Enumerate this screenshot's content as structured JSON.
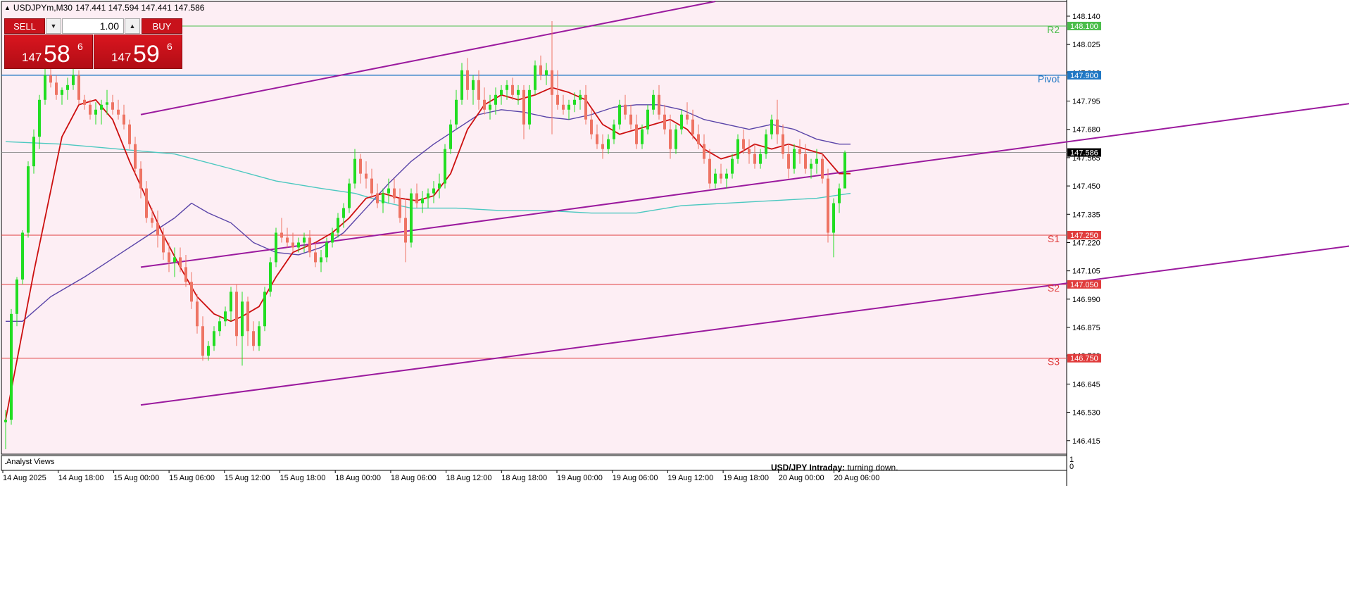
{
  "header": {
    "symbol_info": "USDJPYm,M30",
    "ohlc": "147.441 147.594 147.441 147.586"
  },
  "trade_panel": {
    "sell_label": "SELL",
    "buy_label": "BUY",
    "lot_value": "1.00",
    "sell_price": {
      "prefix": "147",
      "big": "58",
      "sup": "6"
    },
    "buy_price": {
      "prefix": "147",
      "big": "59",
      "sup": "6"
    }
  },
  "indicator_window": {
    "label": ".Analyst Views",
    "caption_bold": "USD/JPY Intraday:",
    "caption_text": "turning down.",
    "scale_top": "1",
    "scale_bottom": "0"
  },
  "colors": {
    "background": "#fdeef4",
    "bull": "#22dd22",
    "bear": "#ee7464",
    "ma_fast": "#cc0f0f",
    "ma_mid": "#5a44a8",
    "ma_slow": "#4cc8c0",
    "channel": "#9b1a9e",
    "pivot": "#1f77c4",
    "resistance": "#4bbd4b",
    "support": "#e03c3c"
  },
  "chart_data": {
    "type": "candlestick",
    "symbol": "USDJPYm",
    "timeframe": "M30",
    "ylim": [
      146.36,
      148.2
    ],
    "y_ticks": [
      "148.140",
      "148.025",
      "147.910",
      "147.795",
      "147.680",
      "147.565",
      "147.450",
      "147.335",
      "147.220",
      "147.105",
      "146.990",
      "146.875",
      "146.760",
      "146.645",
      "146.530",
      "146.415"
    ],
    "x_ticks": [
      "14 Aug 2025",
      "14 Aug 18:00",
      "15 Aug 00:00",
      "15 Aug 06:00",
      "15 Aug 12:00",
      "15 Aug 18:00",
      "18 Aug 00:00",
      "18 Aug 06:00",
      "18 Aug 12:00",
      "18 Aug 18:00",
      "19 Aug 00:00",
      "19 Aug 06:00",
      "19 Aug 12:00",
      "19 Aug 18:00",
      "20 Aug 00:00",
      "20 Aug 06:00"
    ],
    "levels": [
      {
        "name": "R2",
        "value": 148.1,
        "label": "148.100"
      },
      {
        "name": "Pivot",
        "value": 147.9,
        "label": "147.900"
      },
      {
        "name": "S1",
        "value": 147.25,
        "label": "147.250"
      },
      {
        "name": "S2",
        "value": 147.05,
        "label": "147.050"
      },
      {
        "name": "S3",
        "value": 146.75,
        "label": "146.750"
      }
    ],
    "current_price": {
      "value": 147.586,
      "label": "147.586"
    },
    "channel": {
      "upper": [
        [
          24,
          147.74
        ],
        [
          126,
          148.2
        ]
      ],
      "upper2": [
        [
          24,
          147.12
        ],
        [
          250,
          147.82
        ]
      ],
      "lower": [
        [
          24,
          146.56
        ],
        [
          250,
          147.24
        ]
      ]
    },
    "candles": [
      [
        146.49,
        146.54,
        146.38,
        146.5
      ],
      [
        146.5,
        146.95,
        146.48,
        146.93
      ],
      [
        146.93,
        147.08,
        146.88,
        147.07
      ],
      [
        147.07,
        147.27,
        147.05,
        147.26
      ],
      [
        147.26,
        147.55,
        147.24,
        147.53
      ],
      [
        147.53,
        147.68,
        147.5,
        147.65
      ],
      [
        147.65,
        147.82,
        147.6,
        147.8
      ],
      [
        147.8,
        147.93,
        147.78,
        147.9
      ],
      [
        147.9,
        147.96,
        147.85,
        147.87
      ],
      [
        147.87,
        147.9,
        147.8,
        147.82
      ],
      [
        147.82,
        147.85,
        147.78,
        147.84
      ],
      [
        147.84,
        147.89,
        147.8,
        147.86
      ],
      [
        147.86,
        147.95,
        147.84,
        147.9
      ],
      [
        147.9,
        147.92,
        147.78,
        147.8
      ],
      [
        147.8,
        147.82,
        147.76,
        147.78
      ],
      [
        147.78,
        147.8,
        147.72,
        147.74
      ],
      [
        147.74,
        147.79,
        147.7,
        147.76
      ],
      [
        147.76,
        147.8,
        147.7,
        147.78
      ],
      [
        147.78,
        147.84,
        147.74,
        147.79
      ],
      [
        147.79,
        147.82,
        147.74,
        147.76
      ],
      [
        147.76,
        147.8,
        147.72,
        147.74
      ],
      [
        147.74,
        147.78,
        147.68,
        147.7
      ],
      [
        147.7,
        147.72,
        147.6,
        147.62
      ],
      [
        147.62,
        147.65,
        147.5,
        147.52
      ],
      [
        147.52,
        147.55,
        147.4,
        147.44
      ],
      [
        147.44,
        147.47,
        147.3,
        147.32
      ],
      [
        147.32,
        147.36,
        147.28,
        147.3
      ],
      [
        147.3,
        147.35,
        147.2,
        147.25
      ],
      [
        147.25,
        147.28,
        147.15,
        147.18
      ],
      [
        147.18,
        147.22,
        147.1,
        147.14
      ],
      [
        147.14,
        147.2,
        147.08,
        147.16
      ],
      [
        147.16,
        147.2,
        147.1,
        147.12
      ],
      [
        147.12,
        147.17,
        147.04,
        147.06
      ],
      [
        147.06,
        147.1,
        146.95,
        146.98
      ],
      [
        146.98,
        147.01,
        146.85,
        146.88
      ],
      [
        146.88,
        146.92,
        146.74,
        146.76
      ],
      [
        146.76,
        146.82,
        146.74,
        146.8
      ],
      [
        146.8,
        146.88,
        146.78,
        146.86
      ],
      [
        146.86,
        146.92,
        146.84,
        146.9
      ],
      [
        146.9,
        146.96,
        146.88,
        146.94
      ],
      [
        146.94,
        147.04,
        146.9,
        147.02
      ],
      [
        147.02,
        147.05,
        146.8,
        146.84
      ],
      [
        146.84,
        147.02,
        146.72,
        146.98
      ],
      [
        146.98,
        147.0,
        146.8,
        146.86
      ],
      [
        146.86,
        146.9,
        146.78,
        146.8
      ],
      [
        146.8,
        146.9,
        146.78,
        146.88
      ],
      [
        146.88,
        147.04,
        146.86,
        147.02
      ],
      [
        147.02,
        147.16,
        147.0,
        147.14
      ],
      [
        147.14,
        147.28,
        147.12,
        147.26
      ],
      [
        147.26,
        147.32,
        147.22,
        147.24
      ],
      [
        147.24,
        147.28,
        147.2,
        147.22
      ],
      [
        147.22,
        147.26,
        147.18,
        147.2
      ],
      [
        147.2,
        147.24,
        147.18,
        147.22
      ],
      [
        147.22,
        147.26,
        147.18,
        147.24
      ],
      [
        147.24,
        147.27,
        147.16,
        147.18
      ],
      [
        147.18,
        147.22,
        147.12,
        147.14
      ],
      [
        147.14,
        147.19,
        147.1,
        147.16
      ],
      [
        147.16,
        147.24,
        147.14,
        147.22
      ],
      [
        147.22,
        147.28,
        147.2,
        147.26
      ],
      [
        147.26,
        147.34,
        147.24,
        147.32
      ],
      [
        147.32,
        147.38,
        147.28,
        147.36
      ],
      [
        147.36,
        147.48,
        147.34,
        147.46
      ],
      [
        147.46,
        147.6,
        147.44,
        147.56
      ],
      [
        147.56,
        147.58,
        147.46,
        147.5
      ],
      [
        147.5,
        147.55,
        147.44,
        147.48
      ],
      [
        147.48,
        147.52,
        147.4,
        147.42
      ],
      [
        147.42,
        147.46,
        147.36,
        147.38
      ],
      [
        147.38,
        147.44,
        147.34,
        147.42
      ],
      [
        147.42,
        147.48,
        147.38,
        147.44
      ],
      [
        147.44,
        147.48,
        147.38,
        147.4
      ],
      [
        147.4,
        147.44,
        147.3,
        147.32
      ],
      [
        147.32,
        147.4,
        147.14,
        147.22
      ],
      [
        147.22,
        147.44,
        147.2,
        147.42
      ],
      [
        147.42,
        147.46,
        147.36,
        147.38
      ],
      [
        147.38,
        147.43,
        147.34,
        147.4
      ],
      [
        147.4,
        147.44,
        147.36,
        147.42
      ],
      [
        147.42,
        147.47,
        147.38,
        147.44
      ],
      [
        147.44,
        147.5,
        147.4,
        147.46
      ],
      [
        147.46,
        147.62,
        147.44,
        147.6
      ],
      [
        147.6,
        147.72,
        147.58,
        147.7
      ],
      [
        147.7,
        147.84,
        147.68,
        147.8
      ],
      [
        147.8,
        147.95,
        147.78,
        147.92
      ],
      [
        147.92,
        147.97,
        147.8,
        147.84
      ],
      [
        147.84,
        147.9,
        147.78,
        147.88
      ],
      [
        147.88,
        147.92,
        147.76,
        147.8
      ],
      [
        147.8,
        147.85,
        147.74,
        147.76
      ],
      [
        147.76,
        147.82,
        147.72,
        147.78
      ],
      [
        147.78,
        147.85,
        147.74,
        147.82
      ],
      [
        147.82,
        147.86,
        147.78,
        147.84
      ],
      [
        147.84,
        147.88,
        147.8,
        147.86
      ],
      [
        147.86,
        147.89,
        147.8,
        147.82
      ],
      [
        147.82,
        147.86,
        147.78,
        147.84
      ],
      [
        147.84,
        147.86,
        147.64,
        147.7
      ],
      [
        147.7,
        147.86,
        147.68,
        147.84
      ],
      [
        147.84,
        147.96,
        147.82,
        147.94
      ],
      [
        147.94,
        147.98,
        147.88,
        147.9
      ],
      [
        147.9,
        147.95,
        147.86,
        147.92
      ],
      [
        147.92,
        148.12,
        147.66,
        147.82
      ],
      [
        147.82,
        147.92,
        147.76,
        147.78
      ],
      [
        147.78,
        147.82,
        147.74,
        147.76
      ],
      [
        147.76,
        147.8,
        147.72,
        147.78
      ],
      [
        147.78,
        147.83,
        147.75,
        147.8
      ],
      [
        147.8,
        147.84,
        147.76,
        147.82
      ],
      [
        147.82,
        147.86,
        147.7,
        147.72
      ],
      [
        147.72,
        147.76,
        147.64,
        147.66
      ],
      [
        147.66,
        147.7,
        147.6,
        147.62
      ],
      [
        147.62,
        147.66,
        147.56,
        147.6
      ],
      [
        147.6,
        147.66,
        147.58,
        147.64
      ],
      [
        147.64,
        147.72,
        147.62,
        147.7
      ],
      [
        147.7,
        147.8,
        147.68,
        147.78
      ],
      [
        147.78,
        147.82,
        147.72,
        147.74
      ],
      [
        147.74,
        147.78,
        147.68,
        147.7
      ],
      [
        147.7,
        147.74,
        147.6,
        147.62
      ],
      [
        147.62,
        147.7,
        147.6,
        147.68
      ],
      [
        147.68,
        147.78,
        147.66,
        147.76
      ],
      [
        147.76,
        147.84,
        147.74,
        147.82
      ],
      [
        147.82,
        147.86,
        147.72,
        147.74
      ],
      [
        147.74,
        147.78,
        147.66,
        147.68
      ],
      [
        147.68,
        147.74,
        147.56,
        147.6
      ],
      [
        147.6,
        147.7,
        147.58,
        147.68
      ],
      [
        147.68,
        147.76,
        147.66,
        147.74
      ],
      [
        147.74,
        147.79,
        147.7,
        147.72
      ],
      [
        147.72,
        147.76,
        147.64,
        147.66
      ],
      [
        147.66,
        147.7,
        147.6,
        147.62
      ],
      [
        147.62,
        147.66,
        147.54,
        147.56
      ],
      [
        147.56,
        147.6,
        147.44,
        147.46
      ],
      [
        147.46,
        147.52,
        147.44,
        147.5
      ],
      [
        147.5,
        147.54,
        147.46,
        147.48
      ],
      [
        147.48,
        147.52,
        147.44,
        147.5
      ],
      [
        147.5,
        147.58,
        147.48,
        147.56
      ],
      [
        147.56,
        147.66,
        147.54,
        147.64
      ],
      [
        147.64,
        147.68,
        147.58,
        147.6
      ],
      [
        147.6,
        147.64,
        147.54,
        147.58
      ],
      [
        147.58,
        147.62,
        147.52,
        147.54
      ],
      [
        147.54,
        147.6,
        147.52,
        147.58
      ],
      [
        147.58,
        147.68,
        147.56,
        147.66
      ],
      [
        147.66,
        147.74,
        147.64,
        147.72
      ],
      [
        147.72,
        147.8,
        147.62,
        147.66
      ],
      [
        147.66,
        147.7,
        147.56,
        147.58
      ],
      [
        147.58,
        147.62,
        147.48,
        147.52
      ],
      [
        147.52,
        147.62,
        147.5,
        147.6
      ],
      [
        147.6,
        147.64,
        147.54,
        147.58
      ],
      [
        147.58,
        147.62,
        147.5,
        147.52
      ],
      [
        147.52,
        147.56,
        147.48,
        147.54
      ],
      [
        147.54,
        147.6,
        147.5,
        147.56
      ],
      [
        147.56,
        147.58,
        147.46,
        147.48
      ],
      [
        147.48,
        147.52,
        147.22,
        147.26
      ],
      [
        147.26,
        147.4,
        147.16,
        147.38
      ],
      [
        147.38,
        147.46,
        147.34,
        147.44
      ],
      [
        147.44,
        147.594,
        147.441,
        147.586
      ]
    ],
    "ma_fast": [
      [
        0,
        146.5
      ],
      [
        5,
        147.1
      ],
      [
        10,
        147.65
      ],
      [
        13,
        147.78
      ],
      [
        16,
        147.8
      ],
      [
        19,
        147.72
      ],
      [
        22,
        147.55
      ],
      [
        25,
        147.4
      ],
      [
        28,
        147.25
      ],
      [
        31,
        147.12
      ],
      [
        34,
        147.0
      ],
      [
        37,
        146.93
      ],
      [
        40,
        146.9
      ],
      [
        42,
        146.92
      ],
      [
        45,
        146.96
      ],
      [
        48,
        147.08
      ],
      [
        51,
        147.18
      ],
      [
        55,
        147.22
      ],
      [
        58,
        147.26
      ],
      [
        61,
        147.32
      ],
      [
        64,
        147.4
      ],
      [
        67,
        147.42
      ],
      [
        70,
        147.4
      ],
      [
        73,
        147.39
      ],
      [
        76,
        147.41
      ],
      [
        79,
        147.5
      ],
      [
        82,
        147.68
      ],
      [
        85,
        147.78
      ],
      [
        88,
        147.82
      ],
      [
        91,
        147.8
      ],
      [
        94,
        147.82
      ],
      [
        97,
        147.85
      ],
      [
        100,
        147.83
      ],
      [
        103,
        147.8
      ],
      [
        106,
        147.7
      ],
      [
        109,
        147.66
      ],
      [
        112,
        147.68
      ],
      [
        115,
        147.7
      ],
      [
        118,
        147.72
      ],
      [
        121,
        147.68
      ],
      [
        124,
        147.6
      ],
      [
        127,
        147.56
      ],
      [
        130,
        147.58
      ],
      [
        133,
        147.62
      ],
      [
        136,
        147.6
      ],
      [
        139,
        147.62
      ],
      [
        142,
        147.6
      ],
      [
        145,
        147.58
      ],
      [
        148,
        147.5
      ],
      [
        150,
        147.5
      ]
    ],
    "ma_mid": [
      [
        0,
        146.9
      ],
      [
        3,
        146.9
      ],
      [
        8,
        147.0
      ],
      [
        14,
        147.08
      ],
      [
        20,
        147.17
      ],
      [
        26,
        147.26
      ],
      [
        30,
        147.32
      ],
      [
        33,
        147.38
      ],
      [
        36,
        147.34
      ],
      [
        40,
        147.3
      ],
      [
        44,
        147.22
      ],
      [
        48,
        147.18
      ],
      [
        52,
        147.17
      ],
      [
        56,
        147.2
      ],
      [
        60,
        147.26
      ],
      [
        64,
        147.36
      ],
      [
        68,
        147.46
      ],
      [
        72,
        147.55
      ],
      [
        76,
        147.62
      ],
      [
        80,
        147.68
      ],
      [
        84,
        147.74
      ],
      [
        88,
        147.76
      ],
      [
        92,
        147.75
      ],
      [
        96,
        147.73
      ],
      [
        100,
        147.72
      ],
      [
        104,
        147.74
      ],
      [
        108,
        147.77
      ],
      [
        112,
        147.78
      ],
      [
        116,
        147.78
      ],
      [
        120,
        147.76
      ],
      [
        124,
        147.72
      ],
      [
        128,
        147.7
      ],
      [
        132,
        147.68
      ],
      [
        136,
        147.7
      ],
      [
        140,
        147.68
      ],
      [
        144,
        147.64
      ],
      [
        148,
        147.62
      ],
      [
        150,
        147.62
      ]
    ],
    "ma_slow": [
      [
        0,
        147.63
      ],
      [
        10,
        147.62
      ],
      [
        20,
        147.6
      ],
      [
        30,
        147.58
      ],
      [
        40,
        147.52
      ],
      [
        48,
        147.47
      ],
      [
        56,
        147.44
      ],
      [
        62,
        147.42
      ],
      [
        68,
        147.38
      ],
      [
        72,
        147.36
      ],
      [
        80,
        147.36
      ],
      [
        88,
        147.35
      ],
      [
        96,
        147.35
      ],
      [
        104,
        147.34
      ],
      [
        112,
        147.34
      ],
      [
        120,
        147.37
      ],
      [
        128,
        147.38
      ],
      [
        136,
        147.39
      ],
      [
        144,
        147.4
      ],
      [
        150,
        147.42
      ]
    ]
  }
}
